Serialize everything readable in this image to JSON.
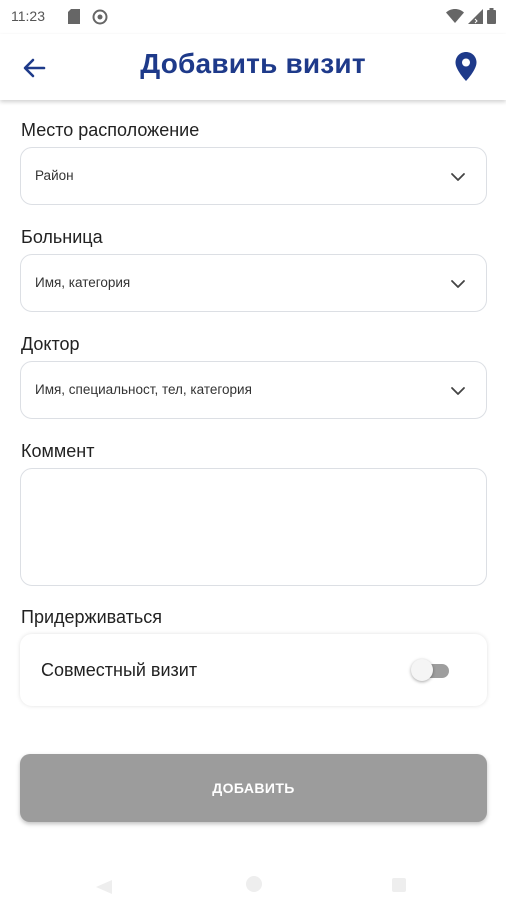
{
  "status_bar": {
    "time": "11:23",
    "icons": [
      "sim-card-icon",
      "do-not-disturb-icon",
      "wifi-icon",
      "cellular-signal-icon",
      "battery-icon"
    ]
  },
  "header": {
    "title": "Добавить визит",
    "back_icon": "arrow-left-icon",
    "location_icon": "map-pin-icon",
    "title_color": "#1e3a8a"
  },
  "form": {
    "location": {
      "label": "Место расположение",
      "placeholder": "Район"
    },
    "hospital": {
      "label": "Больница",
      "placeholder": "Имя, категория"
    },
    "doctor": {
      "label": "Доктор",
      "placeholder": "Имя, специальност, тел, категория"
    },
    "comment": {
      "label": "Коммент",
      "value": ""
    },
    "adhere": {
      "label": "Придерживаться",
      "joint_visit_label": "Совместный визит",
      "joint_visit_enabled": false
    }
  },
  "submit": {
    "label": "ДОБАВИТЬ",
    "color": "#9c9c9c"
  }
}
